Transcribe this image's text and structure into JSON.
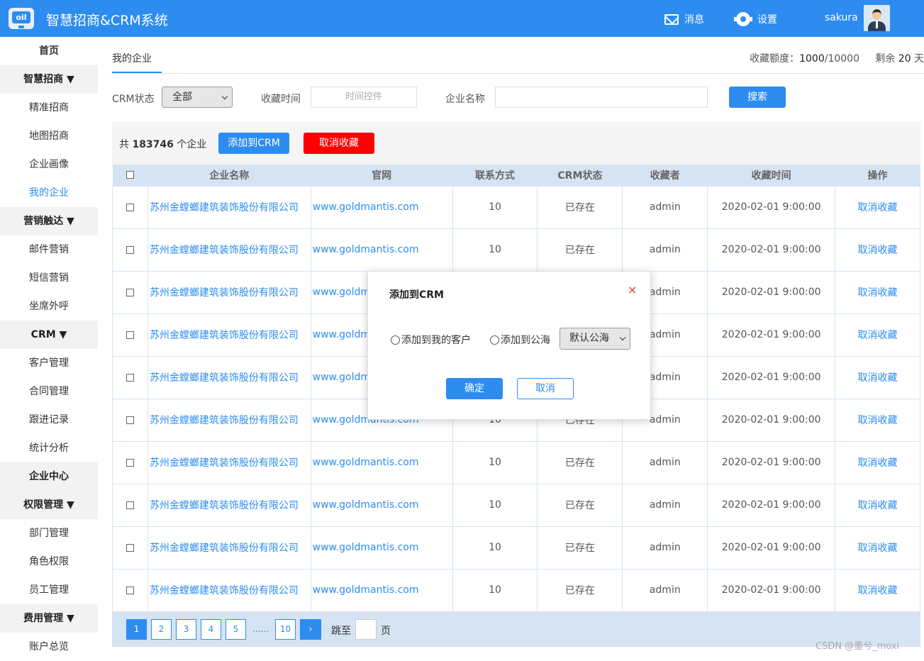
{
  "header": {
    "logo_text": "oil",
    "title": "智慧招商&CRM系统",
    "messages_label": "消息",
    "settings_label": "设置",
    "username": "sakura"
  },
  "sidebar": {
    "items": [
      {
        "label": "首页",
        "type": "home"
      },
      {
        "label": "智慧招商 ▼",
        "type": "group"
      },
      {
        "label": "精准招商",
        "type": "item"
      },
      {
        "label": "地图招商",
        "type": "item"
      },
      {
        "label": "企业画像",
        "type": "item"
      },
      {
        "label": "我的企业",
        "type": "active"
      },
      {
        "label": "营销触达 ▼",
        "type": "group"
      },
      {
        "label": "邮件营销",
        "type": "item"
      },
      {
        "label": "短信营销",
        "type": "item"
      },
      {
        "label": "坐席外呼",
        "type": "item"
      },
      {
        "label": "CRM ▼",
        "type": "group"
      },
      {
        "label": "客户管理",
        "type": "item"
      },
      {
        "label": "合同管理",
        "type": "item"
      },
      {
        "label": "跟进记录",
        "type": "item"
      },
      {
        "label": "统计分析",
        "type": "item"
      },
      {
        "label": "企业中心",
        "type": "group"
      },
      {
        "label": "权限管理 ▼",
        "type": "group"
      },
      {
        "label": "部门管理",
        "type": "item"
      },
      {
        "label": "角色权限",
        "type": "item"
      },
      {
        "label": "员工管理",
        "type": "item"
      },
      {
        "label": "费用管理 ▼",
        "type": "group"
      },
      {
        "label": "账户总览",
        "type": "item"
      }
    ]
  },
  "main": {
    "tab_label": "我的企业",
    "quota_label": "收藏额度：",
    "quota_value": "1000",
    "quota_total": "/10000",
    "remaining_label": "剩余",
    "remaining_value": "20",
    "remaining_unit": "天"
  },
  "filters": {
    "crm_status_label": "CRM状态",
    "crm_status_value": "全部",
    "fav_time_label": "收藏时间",
    "fav_time_placeholder": "时间控件",
    "company_name_label": "企业名称",
    "company_name_value": "",
    "search_label": "搜索"
  },
  "toolbar": {
    "count_prefix": "共",
    "count_value": "183746",
    "count_suffix": "个企业",
    "add_crm_label": "添加到CRM",
    "unfavorite_label": "取消收藏"
  },
  "table": {
    "headers": [
      "",
      "企业名称",
      "官网",
      "联系方式",
      "CRM状态",
      "收藏者",
      "收藏时间",
      "操作"
    ],
    "rows": [
      {
        "company": "苏州金螳螂建筑装饰股份有限公司",
        "website": "www.goldmantis.com",
        "contact": "10",
        "status": "已存在",
        "owner": "admin",
        "time": "2020-02-01  9:00:00",
        "action": "取消收藏"
      },
      {
        "company": "苏州金螳螂建筑装饰股份有限公司",
        "website": "www.goldmantis.com",
        "contact": "10",
        "status": "已存在",
        "owner": "admin",
        "time": "2020-02-01  9:00:00",
        "action": "取消收藏"
      },
      {
        "company": "苏州金螳螂建筑装饰股份有限公司",
        "website": "www.goldm",
        "contact": "",
        "status": "",
        "owner": "admin",
        "time": "2020-02-01  9:00:00",
        "action": "取消收藏"
      },
      {
        "company": "苏州金螳螂建筑装饰股份有限公司",
        "website": "www.goldm",
        "contact": "",
        "status": "",
        "owner": "admin",
        "time": "2020-02-01  9:00:00",
        "action": "取消收藏"
      },
      {
        "company": "苏州金螳螂建筑装饰股份有限公司",
        "website": "www.goldm",
        "contact": "",
        "status": "",
        "owner": "admin",
        "time": "2020-02-01  9:00:00",
        "action": "取消收藏"
      },
      {
        "company": "苏州金螳螂建筑装饰股份有限公司",
        "website": "www.goldmantis.com",
        "contact": "10",
        "status": "已存在",
        "owner": "admin",
        "time": "2020-02-01  9:00:00",
        "action": "取消收藏"
      },
      {
        "company": "苏州金螳螂建筑装饰股份有限公司",
        "website": "www.goldmantis.com",
        "contact": "10",
        "status": "已存在",
        "owner": "admin",
        "time": "2020-02-01  9:00:00",
        "action": "取消收藏"
      },
      {
        "company": "苏州金螳螂建筑装饰股份有限公司",
        "website": "www.goldmantis.com",
        "contact": "10",
        "status": "已存在",
        "owner": "admin",
        "time": "2020-02-01  9:00:00",
        "action": "取消收藏"
      },
      {
        "company": "苏州金螳螂建筑装饰股份有限公司",
        "website": "www.goldmantis.com",
        "contact": "10",
        "status": "已存在",
        "owner": "admin",
        "time": "2020-02-01  9:00:00",
        "action": "取消收藏"
      },
      {
        "company": "苏州金螳螂建筑装饰股份有限公司",
        "website": "www.goldmantis.com",
        "contact": "10",
        "status": "已存在",
        "owner": "admin",
        "time": "2020-02-01  9:00:00",
        "action": "取消收藏"
      }
    ]
  },
  "pagination": {
    "pages": [
      "1",
      "2",
      "3",
      "4",
      "5"
    ],
    "ellipsis": "......",
    "last_page": "10",
    "current": "1",
    "next_label": "›",
    "jump_label": "跳至",
    "jump_suffix": "页"
  },
  "modal": {
    "title": "添加到CRM",
    "close_label": "×",
    "option_my_customers": "添加到我的客户",
    "option_public_pool": "添加到公海",
    "pool_select_value": "默认公海",
    "ok_label": "确定",
    "cancel_label": "取消"
  },
  "watermark": "CSDN @墨兮_moxi",
  "colors": {
    "primary": "#2d8cf0",
    "danger": "#ff0000",
    "table_header": "#d6e3f2"
  }
}
